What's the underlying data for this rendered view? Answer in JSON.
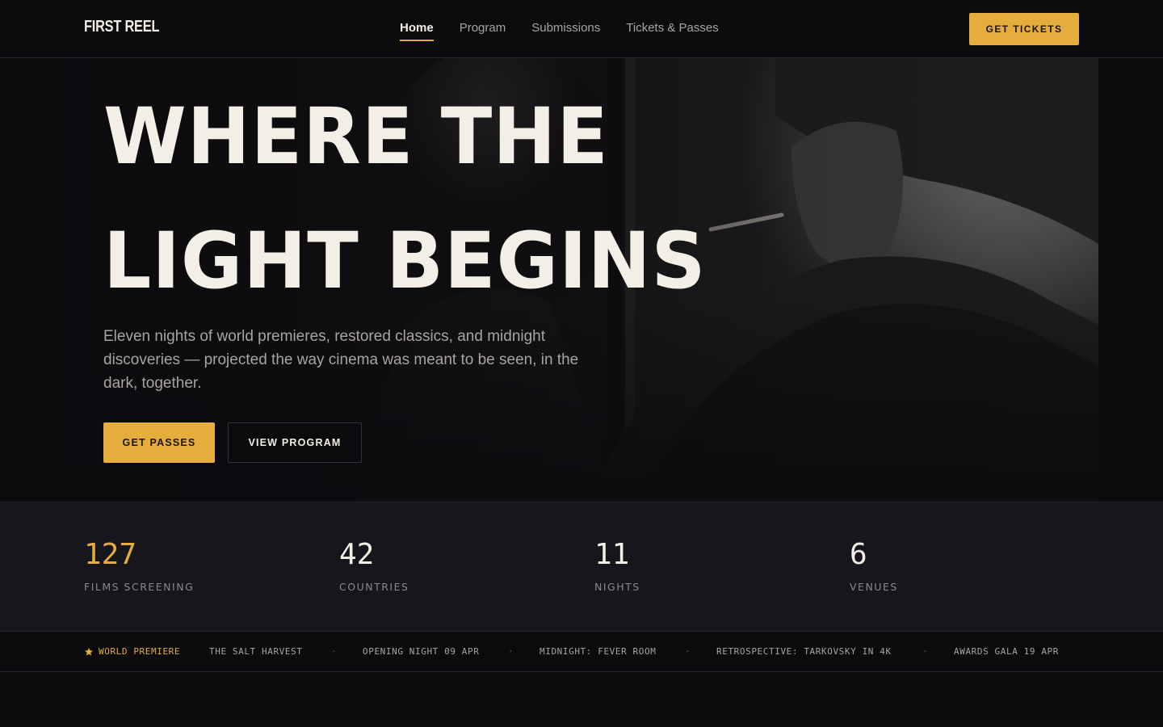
{
  "brand": {
    "logo": "FIRST REEL"
  },
  "nav": {
    "items": [
      {
        "label": "Home",
        "active": true
      },
      {
        "label": "Program",
        "active": false
      },
      {
        "label": "Submissions",
        "active": false
      },
      {
        "label": "Tickets & Passes",
        "active": false
      }
    ],
    "cta": "GET TICKETS"
  },
  "hero": {
    "title_line1": "WHERE THE",
    "title_line2": "LIGHT BEGINS",
    "description": "Eleven nights of world premieres, restored classics, and midnight discoveries — projected the way cinema was meant to be seen, in the dark, together.",
    "primary_button": "GET PASSES",
    "secondary_button": "VIEW PROGRAM"
  },
  "stats": [
    {
      "value": "127",
      "label": "FILMS SCREENING"
    },
    {
      "value": "42",
      "label": "COUNTRIES"
    },
    {
      "value": "11",
      "label": "NIGHTS"
    },
    {
      "value": "6",
      "label": "VENUES"
    }
  ],
  "ticker": {
    "badge": "WORLD PREMIERE",
    "items": [
      "THE SALT HARVEST",
      "OPENING NIGHT 09 APR",
      "MIDNIGHT: FEVER ROOM",
      "RETROSPECTIVE: TARKOVSKY IN 4K",
      "AWARDS GALA 19 APR"
    ],
    "separator": "·"
  },
  "colors": {
    "accent": "#e4ad3c",
    "background": "#0b0a0d",
    "panel": "#17161c",
    "text": "#f3efe6",
    "muted": "#a9a4a0"
  }
}
